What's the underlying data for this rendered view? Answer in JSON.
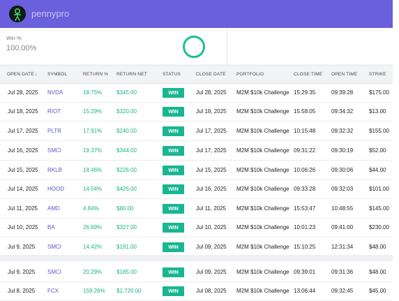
{
  "brand": {
    "name": "pennypro"
  },
  "stats": {
    "label": "Win %",
    "value": "100.00%"
  },
  "table": {
    "headers": {
      "open_date": "OPEN DATE",
      "symbol": "SYMBOL",
      "return_pct": "RETURN %",
      "return_net": "RETURN NET",
      "status": "STATUS",
      "close_date": "CLOSE DATE",
      "portfolio": "PORTFOLIO",
      "close_time": "CLOSE TIME",
      "open_time": "OPEN TIME",
      "strike": "STRIKE"
    },
    "rows": [
      {
        "open_date": "Jul 28, 2025",
        "symbol": "NVDA",
        "return_pct": "18.75%",
        "return_net": "$345.00",
        "status": "WIN",
        "close_date": "Jul 28, 2025",
        "portfolio": "M2M $10k Challenge",
        "close_time": "15:29:35",
        "open_time": "09:39:28",
        "strike": "$175.00"
      },
      {
        "open_date": "Jul 18, 2025",
        "symbol": "RIOT",
        "return_pct": "15.29%",
        "return_net": "$320.00",
        "status": "WIN",
        "close_date": "Jul 18, 2025",
        "portfolio": "M2M $10k Challenge",
        "close_time": "15:58:05",
        "open_time": "09:34:32",
        "strike": "$13.00"
      },
      {
        "open_date": "Jul 17, 2025",
        "symbol": "PLTR",
        "return_pct": "17.91%",
        "return_net": "$240.00",
        "status": "WIN",
        "close_date": "Jul 17, 2025",
        "portfolio": "M2M $10k Challenge",
        "close_time": "10:15:48",
        "open_time": "09:32:32",
        "strike": "$155.00"
      },
      {
        "open_date": "Jul 16, 2025",
        "symbol": "SMCI",
        "return_pct": "19.37%",
        "return_net": "$344.00",
        "status": "WIN",
        "close_date": "Jul 17, 2025",
        "portfolio": "M2M $10k Challenge",
        "close_time": "09:31:22",
        "open_time": "09:30:19",
        "strike": "$52.00"
      },
      {
        "open_date": "Jul 15, 2025",
        "symbol": "RKLB",
        "return_pct": "18.46%",
        "return_net": "$226.00",
        "status": "WIN",
        "close_date": "Jul 15, 2025",
        "portfolio": "M2M $10k Challenge",
        "close_time": "10:06:26",
        "open_time": "09:30:06",
        "strike": "$44.00"
      },
      {
        "open_date": "Jul 14, 2025",
        "symbol": "HOOD",
        "return_pct": "14.04%",
        "return_net": "$426.00",
        "status": "WIN",
        "close_date": "Jul 16, 2025",
        "portfolio": "M2M $10k Challenge",
        "close_time": "09:33:28",
        "open_time": "09:32:03",
        "strike": "$101.00"
      },
      {
        "open_date": "Jul 11, 2025",
        "symbol": "AMD",
        "return_pct": "4.84%",
        "return_net": "$80.00",
        "status": "WIN",
        "close_date": "Jul 11, 2025",
        "portfolio": "M2M $10k Challenge",
        "close_time": "15:53:47",
        "open_time": "10:48:55",
        "strike": "$145.00"
      },
      {
        "open_date": "Jul 10, 2025",
        "symbol": "BA",
        "return_pct": "26.69%",
        "return_net": "$327.00",
        "status": "WIN",
        "close_date": "Jul 10, 2025",
        "portfolio": "M2M $10k Challenge",
        "close_time": "10:01:23",
        "open_time": "09:41:00",
        "strike": "$230.00"
      },
      {
        "open_date": "Jul 9, 2025",
        "symbol": "SMCI",
        "return_pct": "14.42%",
        "return_net": "$191.00",
        "status": "WIN",
        "close_date": "Jul 09, 2025",
        "portfolio": "M2M $10k Challenge",
        "close_time": "15:10:25",
        "open_time": "12:31:34",
        "strike": "$48.00"
      },
      {
        "open_date": "Jul 9, 2025",
        "symbol": "SMCI",
        "return_pct": "20.29%",
        "return_net": "$185.00",
        "status": "WIN",
        "close_date": "Jul 09, 2025",
        "portfolio": "M2M $10k Challenge",
        "close_time": "09:39:01",
        "open_time": "09:31:36",
        "strike": "$48.00"
      },
      {
        "open_date": "Jul 8, 2025",
        "symbol": "FCX",
        "return_pct": "159.26%",
        "return_net": "$1,720.00",
        "status": "WIN",
        "close_date": "Jul 08, 2025",
        "portfolio": "M2M $10k Challenge",
        "close_time": "13:06:44",
        "open_time": "09:32:45",
        "strike": "$45.00"
      }
    ]
  },
  "colors": {
    "header": "#6a5fdc",
    "win": "#19b691",
    "symbol": "#5a58c8",
    "return": "#18b38a"
  }
}
